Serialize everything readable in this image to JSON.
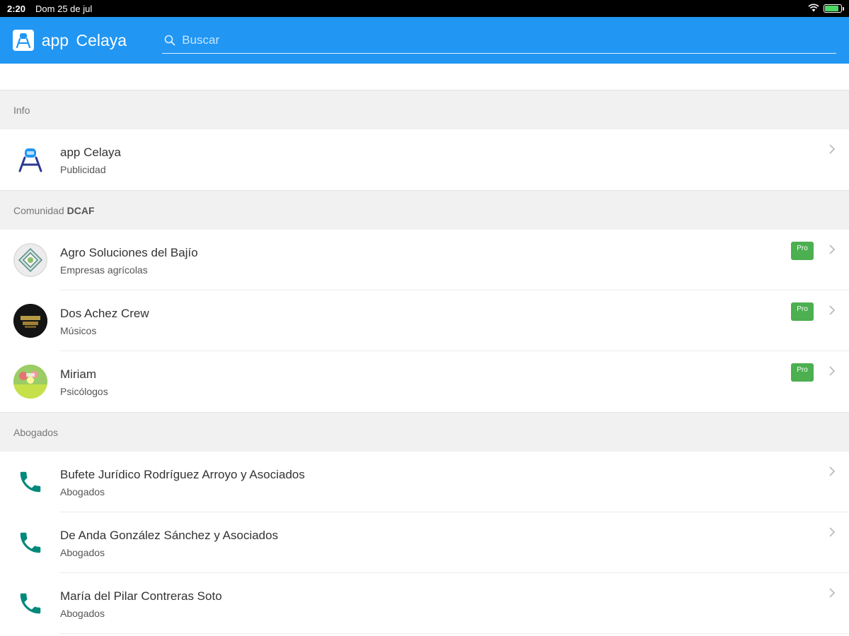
{
  "status_bar": {
    "time": "2:20",
    "date": "Dom 25 de jul",
    "wifi_icon": "wifi-icon",
    "battery_icon": "battery-icon",
    "battery_level_percent": 85
  },
  "app_bar": {
    "title": "app Celaya",
    "logo_icon": "app-logo-icon",
    "search_placeholder": "Buscar",
    "search_value": "",
    "background_color": "#2196f3"
  },
  "sections": [
    {
      "header": "Info",
      "header_bold": "",
      "rows": [
        {
          "title": "app Celaya",
          "subtitle": "Publicidad",
          "icon": "app-logo-icon",
          "pro": false
        }
      ]
    },
    {
      "header": "Comunidad",
      "header_bold": "DCAF",
      "rows": [
        {
          "title": "Agro Soluciones del Bajío",
          "subtitle": "Empresas agrícolas",
          "icon": "agro-logo-avatar",
          "pro": true,
          "pro_label": "Pro"
        },
        {
          "title": "Dos Achez Crew",
          "subtitle": "Músicos",
          "icon": "dos-achez-avatar",
          "pro": true,
          "pro_label": "Pro"
        },
        {
          "title": "Miriam",
          "subtitle": "Psicólogos",
          "icon": "miriam-avatar",
          "pro": true,
          "pro_label": "Pro"
        }
      ]
    },
    {
      "header": "Abogados",
      "header_bold": "",
      "rows": [
        {
          "title": "Bufete Jurídico Rodríguez Arroyo y Asociados",
          "subtitle": "Abogados",
          "icon": "phone-icon",
          "pro": false
        },
        {
          "title": "De Anda González Sánchez y Asociados",
          "subtitle": "Abogados",
          "icon": "phone-icon",
          "pro": false
        },
        {
          "title": "María del Pilar Contreras Soto",
          "subtitle": "Abogados",
          "icon": "phone-icon",
          "pro": false
        }
      ]
    }
  ],
  "colors": {
    "accent": "#2196f3",
    "pro_badge": "#4caf50",
    "phone_icon": "#00897b"
  }
}
